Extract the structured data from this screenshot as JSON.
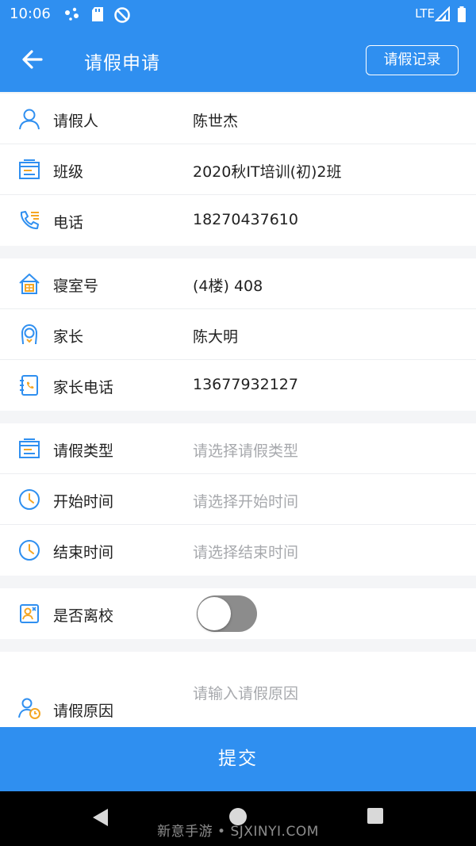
{
  "status_bar": {
    "time": "10:06",
    "network": "LTE"
  },
  "header": {
    "title": "请假申请",
    "record_button": "请假记录"
  },
  "group1": [
    {
      "label": "请假人",
      "value": "陈世杰"
    },
    {
      "label": "班级",
      "value": "2020秋IT培训(初)2班"
    },
    {
      "label": "电话",
      "value": "18270437610"
    }
  ],
  "group2": [
    {
      "label": "寝室号",
      "value": "(4楼) 408"
    },
    {
      "label": "家长",
      "value": "陈大明"
    },
    {
      "label": "家长电话",
      "value": "13677932127"
    }
  ],
  "group3": [
    {
      "label": "请假类型",
      "placeholder": "请选择请假类型"
    },
    {
      "label": "开始时间",
      "placeholder": "请选择开始时间"
    },
    {
      "label": "结束时间",
      "placeholder": "请选择结束时间"
    }
  ],
  "leave_school": {
    "label": "是否离校",
    "on": false
  },
  "reason": {
    "label": "请假原因",
    "placeholder": "请输入请假原因"
  },
  "submit_label": "提交",
  "watermark": "新意手游 • SJXINYI.COM",
  "colors": {
    "primary": "#2f8ff0",
    "icon_blue": "#2f8ff0",
    "icon_orange": "#f5a623"
  }
}
